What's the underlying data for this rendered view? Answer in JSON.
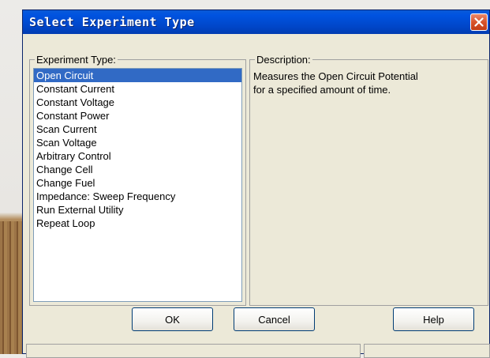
{
  "window": {
    "title": "Select Experiment Type",
    "close_icon": "close-icon"
  },
  "experiment_type": {
    "label": "Experiment Type:",
    "items": [
      "Open Circuit",
      "Constant Current",
      "Constant Voltage",
      "Constant Power",
      "Scan Current",
      "Scan Voltage",
      "Arbitrary Control",
      "Change Cell",
      "Change Fuel",
      "Impedance: Sweep Frequency",
      "Run External Utility",
      "Repeat Loop"
    ],
    "selected": "Open Circuit"
  },
  "description": {
    "label": "Description:",
    "text_line1": "Measures the Open Circuit Potential",
    "text_line2": "for a specified amount of time."
  },
  "buttons": {
    "ok": "OK",
    "cancel": "Cancel",
    "help": "Help"
  },
  "colors": {
    "titlebar": "#0053e0",
    "selection": "#316ac5",
    "close_button": "#d8532b",
    "dialog_face": "#ece9d8"
  }
}
